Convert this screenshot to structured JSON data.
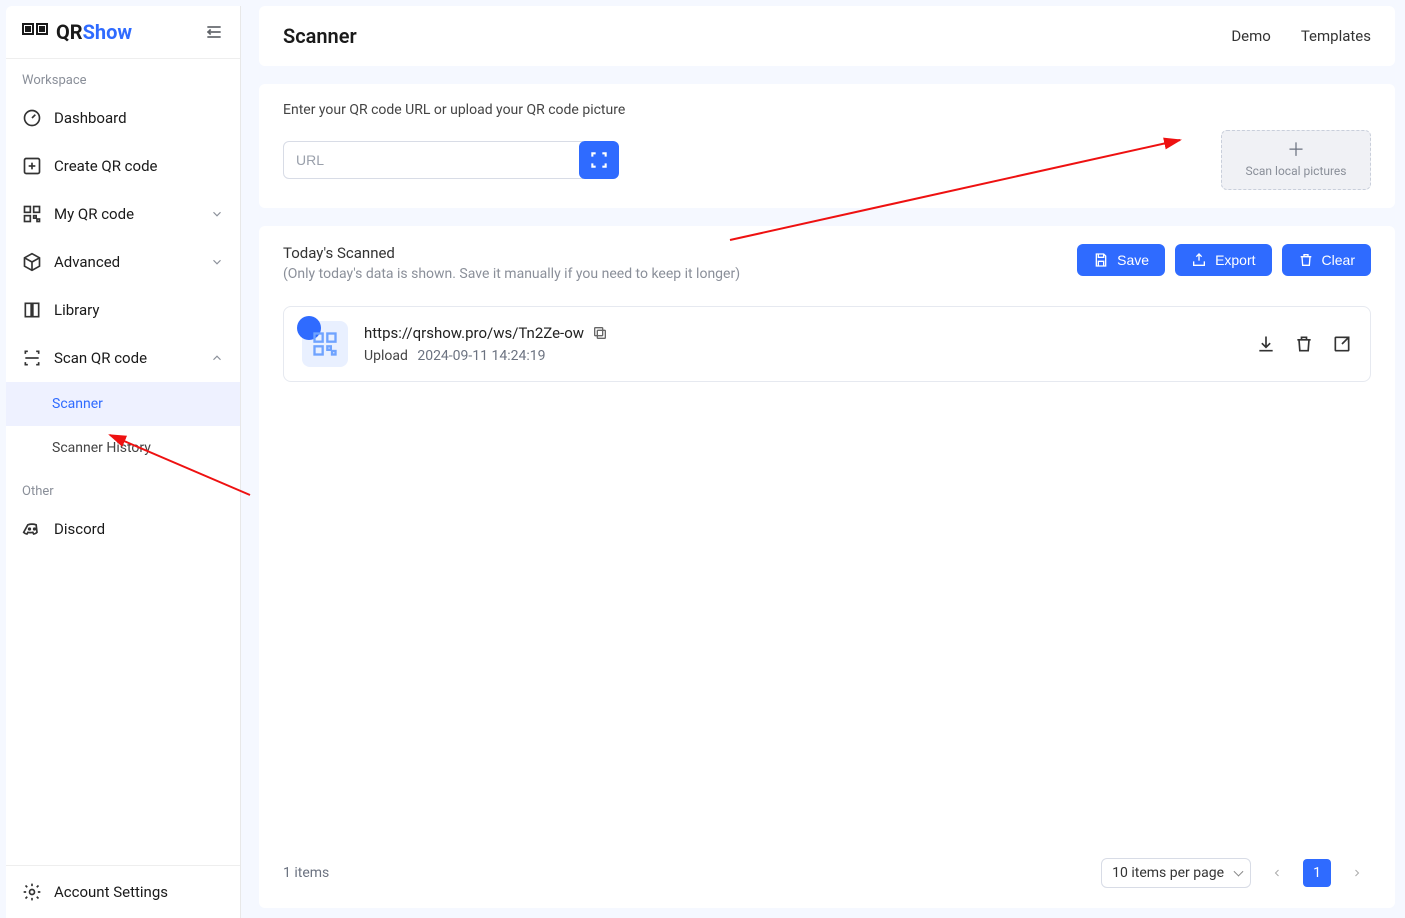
{
  "brand": {
    "prefix": "QR",
    "suffix": "Show"
  },
  "sidebar": {
    "section_workspace": "Workspace",
    "section_other": "Other",
    "dashboard": "Dashboard",
    "create": "Create QR code",
    "myqr": "My QR code",
    "advanced": "Advanced",
    "library": "Library",
    "scan": "Scan QR code",
    "scanner": "Scanner",
    "history": "Scanner History",
    "discord": "Discord",
    "account": "Account Settings"
  },
  "header": {
    "title": "Scanner",
    "demo": "Demo",
    "templates": "Templates"
  },
  "input": {
    "hint": "Enter your QR code URL or upload your QR code picture",
    "placeholder": "URL",
    "upload": "Scan local pictures"
  },
  "list": {
    "title": "Today's Scanned",
    "sub": "(Only today's data is shown. Save it manually if you need to keep it longer)",
    "save": "Save",
    "export": "Export",
    "clear": "Clear"
  },
  "item": {
    "url": "https://qrshow.pro/ws/Tn2Ze-ow",
    "source_label": "Upload",
    "time": "2024-09-11 14:24:19"
  },
  "footer": {
    "count": "1 items",
    "per_page": "10 items per page",
    "page": "1"
  }
}
